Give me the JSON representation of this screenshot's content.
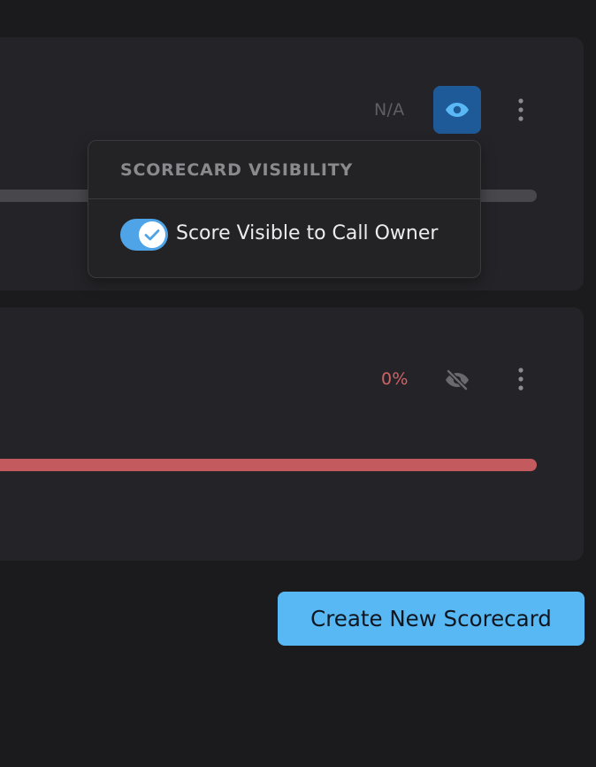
{
  "cards": [
    {
      "score_text": "N/A",
      "visibility_icon": "eye-icon",
      "visibility_active": true,
      "more_icon": "kebab-menu-icon",
      "progress_fraction": 0,
      "progress_color": "#48484c"
    },
    {
      "score_text": "0%",
      "score_color": "#d06266",
      "visibility_icon": "eye-off-icon",
      "visibility_active": false,
      "more_icon": "kebab-menu-icon",
      "progress_fraction": 1,
      "progress_color": "#c25a5e"
    }
  ],
  "visibility_popover": {
    "title": "SCORECARD VISIBILITY",
    "toggle_label": "Score Visible to Call Owner",
    "toggle_on": true
  },
  "create_button": {
    "label": "Create New Scorecard"
  },
  "colors": {
    "background": "#1b1b1d",
    "card": "#242428",
    "accent": "#57b8f4",
    "active_button": "#1f5a98"
  }
}
